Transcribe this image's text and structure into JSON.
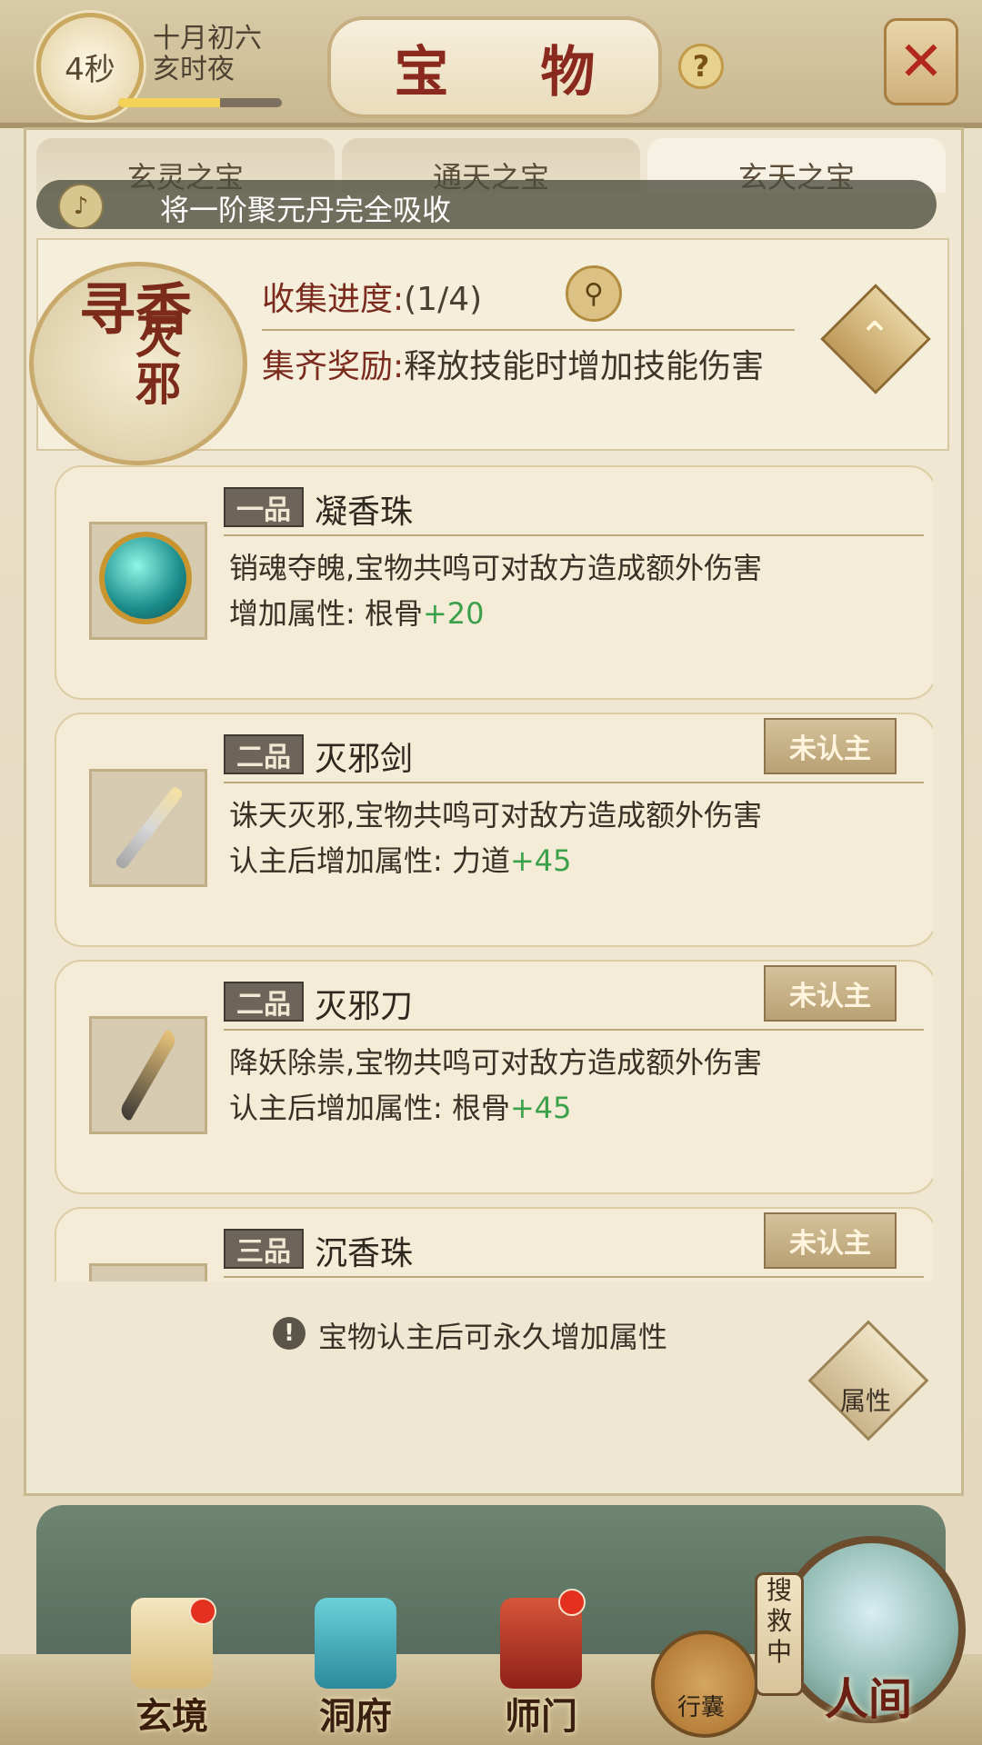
{
  "header": {
    "timer": "4秒",
    "lunar_date": "十月初六",
    "time_of_day": "亥时夜",
    "time_progress": 0.62,
    "title": "宝 物",
    "help_icon": "question-icon",
    "close_icon": "close-icon"
  },
  "tabs": [
    {
      "label": "玄灵之宝",
      "active": false
    },
    {
      "label": "通天之宝",
      "active": false
    },
    {
      "label": "玄天之宝",
      "active": true
    }
  ],
  "ticker": {
    "text": "将一阶聚元丹完全吸收"
  },
  "collection": {
    "seal_text_1": "寻香",
    "seal_text_2": "灭邪",
    "progress_label": "收集进度:",
    "progress_value": "(1/4)",
    "reward_label": "集齐奖励:",
    "reward_text": "释放技能时增加技能伤害"
  },
  "items": [
    {
      "grade": "一品",
      "name": "凝香珠",
      "description": "销魂夺魄,宝物共鸣可对敌方造成额外伤害",
      "attr_text": "增加属性: 根骨",
      "attr_value": "+20",
      "badge": ""
    },
    {
      "grade": "二品",
      "name": "灭邪剑",
      "description": "诛天灭邪,宝物共鸣可对敌方造成额外伤害",
      "attr_text": "认主后增加属性: 力道",
      "attr_value": "+45",
      "badge": "未认主"
    },
    {
      "grade": "二品",
      "name": "灭邪刀",
      "description": "降妖除祟,宝物共鸣可对敌方造成额外伤害",
      "attr_text": "认主后增加属性: 根骨",
      "attr_value": "+45",
      "badge": "未认主"
    },
    {
      "grade": "三品",
      "name": "沉香珠",
      "description": "",
      "attr_text": "",
      "attr_value": "",
      "badge": "未认主"
    }
  ],
  "tip": "宝物认主后可永久增加属性",
  "attr_button": "属性",
  "bottom_nav": [
    {
      "label": "玄境",
      "icon": "scroll-icon",
      "active": true,
      "has_dot": true
    },
    {
      "label": "洞府",
      "icon": "pavilion-icon",
      "active": false,
      "has_dot": false
    },
    {
      "label": "师门",
      "icon": "banner-icon",
      "active": false,
      "has_dot": true
    }
  ],
  "bag_label": "行囊",
  "rescue_label": "搜救中",
  "world_label": "人间",
  "colors": {
    "accent_red": "#8a2a1e",
    "stat_green": "#3aa04a",
    "notification_red": "#e3301f"
  }
}
